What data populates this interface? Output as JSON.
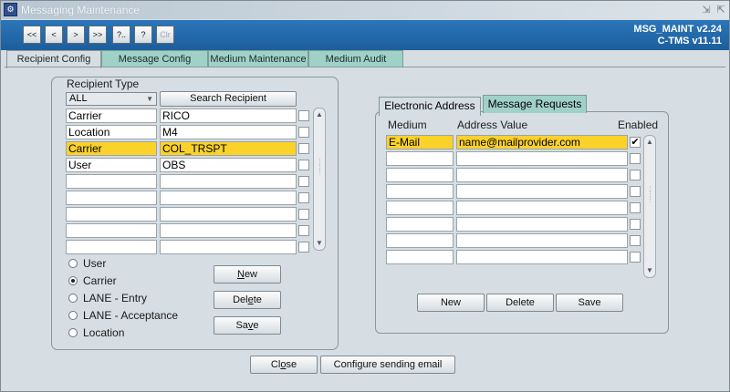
{
  "window": {
    "title": "Messaging Maintenance",
    "app_icon": "app-logo-icon",
    "controls": [
      "minimize-icon",
      "restore-icon"
    ]
  },
  "toolbar": {
    "buttons": [
      {
        "label": "<<",
        "name": "first-record-button",
        "enabled": true
      },
      {
        "label": "<",
        "name": "prev-record-button",
        "enabled": true
      },
      {
        "label": ">",
        "name": "next-record-button",
        "enabled": true
      },
      {
        "label": ">>",
        "name": "last-record-button",
        "enabled": true
      },
      {
        "label": "?..",
        "name": "list-values-button",
        "enabled": true
      },
      {
        "label": "?",
        "name": "help-button",
        "enabled": true
      },
      {
        "label": "Clr",
        "name": "clear-button",
        "enabled": false
      }
    ],
    "version": "MSG_MAINT v2.24",
    "system": "C-TMS v11.11"
  },
  "tabs": [
    "Recipient Config",
    "Message Config",
    "Medium Maintenance",
    "Medium Audit"
  ],
  "recipient": {
    "frame_label": "Recipient Type",
    "type_select": "ALL",
    "search_button": "Search Recipient",
    "rows": [
      {
        "type": "Carrier",
        "value": "RICO"
      },
      {
        "type": "Location",
        "value": "M4"
      },
      {
        "type": "Carrier",
        "value": "COL_TRSPT"
      },
      {
        "type": "User",
        "value": "OBS"
      },
      {
        "type": "",
        "value": ""
      },
      {
        "type": "",
        "value": ""
      },
      {
        "type": "",
        "value": ""
      },
      {
        "type": "",
        "value": ""
      },
      {
        "type": "",
        "value": ""
      }
    ],
    "radios": [
      "User",
      "Carrier",
      "LANE - Entry",
      "LANE - Acceptance",
      "Location"
    ],
    "selected_radio": "Carrier",
    "buttons": {
      "new_pre": "",
      "new_ul": "N",
      "new_post": "ew",
      "delete_pre": "Del",
      "delete_ul": "e",
      "delete_post": "te",
      "save_pre": "Sa",
      "save_ul": "v",
      "save_post": "e"
    }
  },
  "right_tabs": [
    "Electronic Address",
    "Message Requests"
  ],
  "address": {
    "headers": {
      "medium": "Medium",
      "value": "Address Value",
      "enabled": "Enabled"
    },
    "rows": [
      {
        "medium": "E-Mail",
        "value": "name@mailprovider.com",
        "enabled": true
      },
      {
        "medium": "",
        "value": "",
        "enabled": false
      },
      {
        "medium": "",
        "value": "",
        "enabled": false
      },
      {
        "medium": "",
        "value": "",
        "enabled": false
      },
      {
        "medium": "",
        "value": "",
        "enabled": false
      },
      {
        "medium": "",
        "value": "",
        "enabled": false
      },
      {
        "medium": "",
        "value": "",
        "enabled": false
      },
      {
        "medium": "",
        "value": "",
        "enabled": false
      }
    ],
    "buttons": {
      "new": "New",
      "delete": "Delete",
      "save": "Save"
    }
  },
  "footer": {
    "close_pre": "Cl",
    "close_ul": "o",
    "close_post": "se",
    "configure": "Configure sending email"
  },
  "colors": {
    "toolbar": "#2b76b9",
    "selected_row": "#fbd22a",
    "tab": "#9fd1c9"
  }
}
